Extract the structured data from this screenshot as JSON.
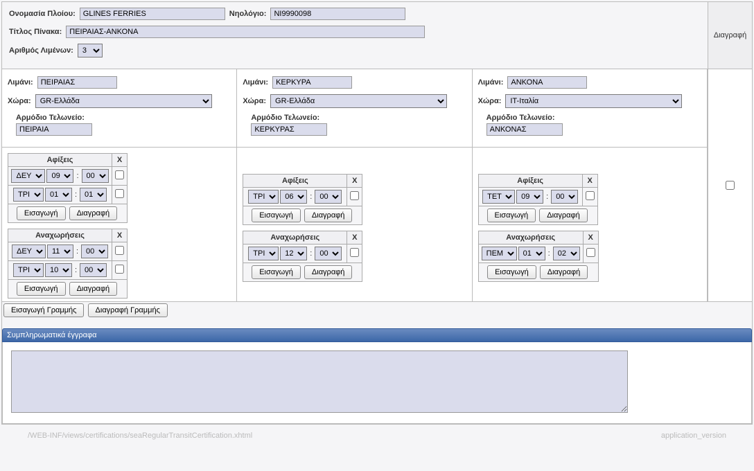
{
  "ship": {
    "name_label": "Ονομασία Πλοίου:",
    "name_value": "GLINES FERRIES",
    "registry_label": "Νηολόγιο:",
    "registry_value": "NI9990098"
  },
  "table": {
    "title_label": "Τίτλος Πίνακα:",
    "title_value": "ΠΕΙΡΑΙΑΣ-ΑΝΚΟΝΑ",
    "ports_count_label": "Αριθμός Λιμένων:",
    "ports_count_value": "3"
  },
  "delete_label": "Διαγραφή",
  "port_label": "Λιμάνι:",
  "country_label": "Χώρα:",
  "customs_label": "Αρμόδιο Τελωνείο:",
  "arrivals_label": "Αφίξεις",
  "departures_label": "Αναχωρήσεις",
  "x_label": "X",
  "insert_label": "Εισαγωγή",
  "row_delete_label": "Διαγραφή",
  "insert_line_label": "Εισαγωγή Γραμμής",
  "delete_line_label": "Διαγραφή Γραμμής",
  "countries": {
    "gr": "GR-Ελλάδα",
    "it": "IT-Ιταλία"
  },
  "days": {
    "deu": "ΔΕΥ",
    "tri": "ΤΡΙ",
    "tet": "ΤΕΤ",
    "pem": "ΠΕΜ"
  },
  "ports": [
    {
      "port_name": "ΠΕΙΡΑΙΑΣ",
      "country": "GR-Ελλάδα",
      "customs": "ΠΕΙΡΑΙΑ",
      "arrivals": [
        {
          "day": "ΔΕΥ",
          "hh": "09",
          "mm": "00"
        },
        {
          "day": "ΤΡΙ",
          "hh": "01",
          "mm": "01"
        }
      ],
      "departures": [
        {
          "day": "ΔΕΥ",
          "hh": "11",
          "mm": "00"
        },
        {
          "day": "ΤΡΙ",
          "hh": "10",
          "mm": "00"
        }
      ]
    },
    {
      "port_name": "ΚΕΡΚΥΡΑ",
      "country": "GR-Ελλάδα",
      "customs": "ΚΕΡΚΥΡΑΣ",
      "arrivals": [
        {
          "day": "ΤΡΙ",
          "hh": "06",
          "mm": "00"
        }
      ],
      "departures": [
        {
          "day": "ΤΡΙ",
          "hh": "12",
          "mm": "00"
        }
      ]
    },
    {
      "port_name": "ΑΝΚΟΝΑ",
      "country": "IT-Ιταλία",
      "customs": "ΑΝΚΟΝΑΣ",
      "arrivals": [
        {
          "day": "ΤΕΤ",
          "hh": "09",
          "mm": "00"
        }
      ],
      "departures": [
        {
          "day": "ΠΕΜ",
          "hh": "01",
          "mm": "02"
        }
      ]
    }
  ],
  "docs_header": "Συμπληρωματικά έγγραφα",
  "footer_path": "/WEB-INF/views/certifications/seaRegularTransitCertification.xhtml",
  "footer_version": "application_version"
}
